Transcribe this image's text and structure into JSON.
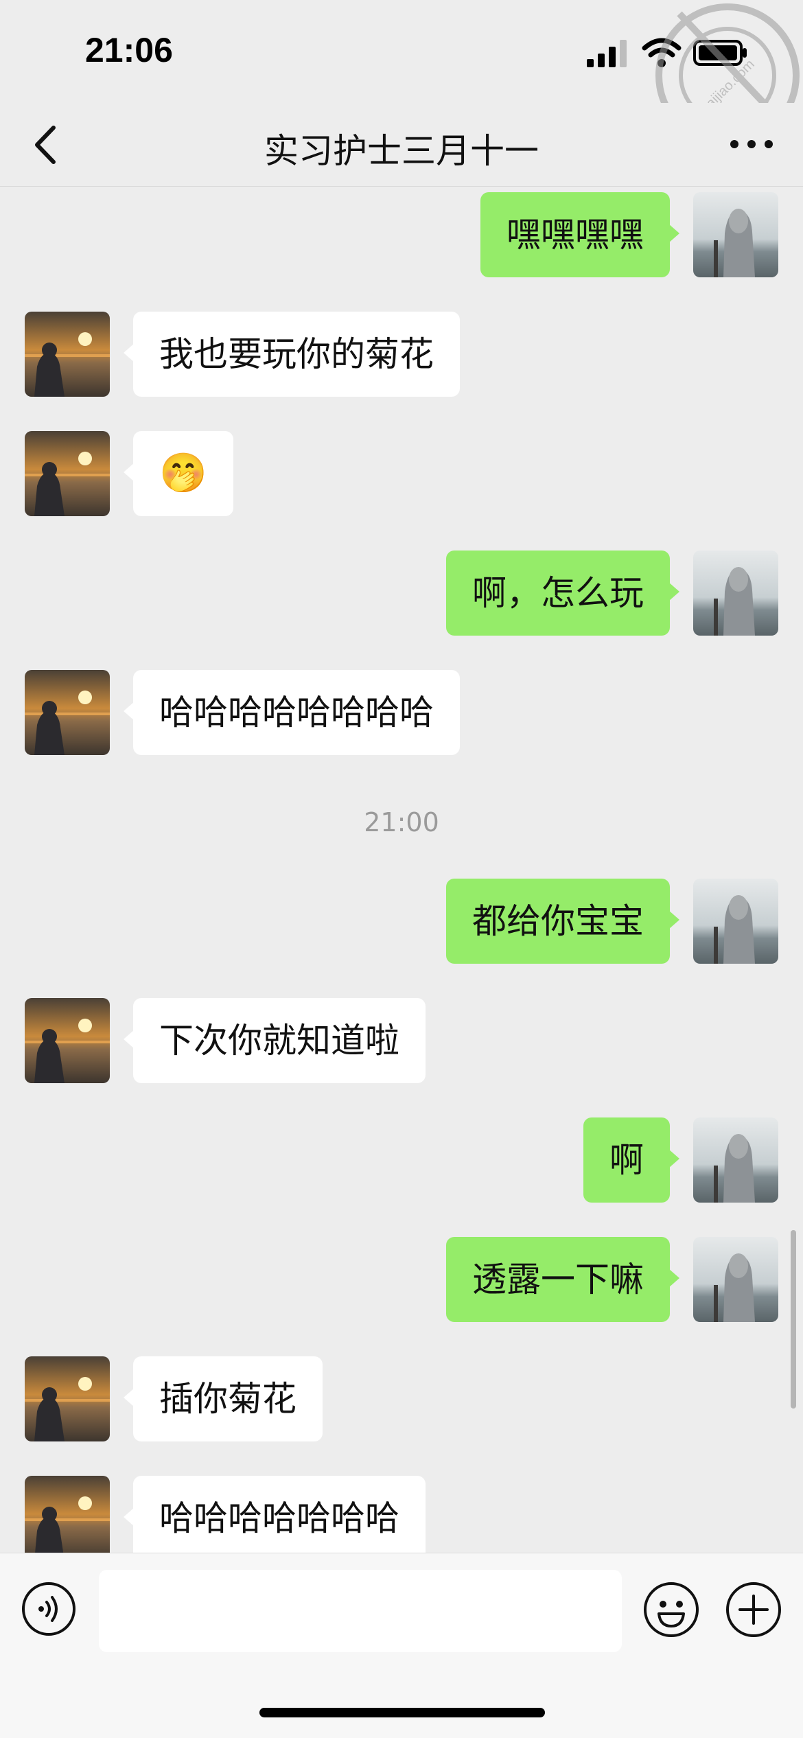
{
  "status_bar": {
    "time": "21:06"
  },
  "header": {
    "title": "实习护士三月十一"
  },
  "watermark": {
    "text": "taijiao.com"
  },
  "messages": [
    {
      "side": "self",
      "text": "嘿嘿嘿嘿"
    },
    {
      "side": "other",
      "text": "我也要玩你的菊花"
    },
    {
      "side": "other",
      "text": "🤭"
    },
    {
      "side": "self",
      "text": "啊，怎么玩"
    },
    {
      "side": "other",
      "text": "哈哈哈哈哈哈哈哈"
    },
    {
      "side": "self",
      "text": "都给你宝宝"
    },
    {
      "side": "other",
      "text": "下次你就知道啦"
    },
    {
      "side": "self",
      "text": "啊"
    },
    {
      "side": "self",
      "text": "透露一下嘛"
    },
    {
      "side": "other",
      "text": "插你菊花"
    },
    {
      "side": "other",
      "text": "哈哈哈哈哈哈哈"
    }
  ],
  "timestamps": [
    {
      "text": "21:00"
    }
  ],
  "input": {
    "value": "",
    "placeholder": ""
  },
  "colors": {
    "self_bubble": "#95ec69",
    "other_bubble": "#ffffff",
    "background": "#ededed"
  },
  "icons": {
    "back": "chevron-left-icon",
    "more": "more-dots-icon",
    "voice": "voice-icon",
    "emoji": "emoji-icon",
    "plus": "plus-icon"
  }
}
